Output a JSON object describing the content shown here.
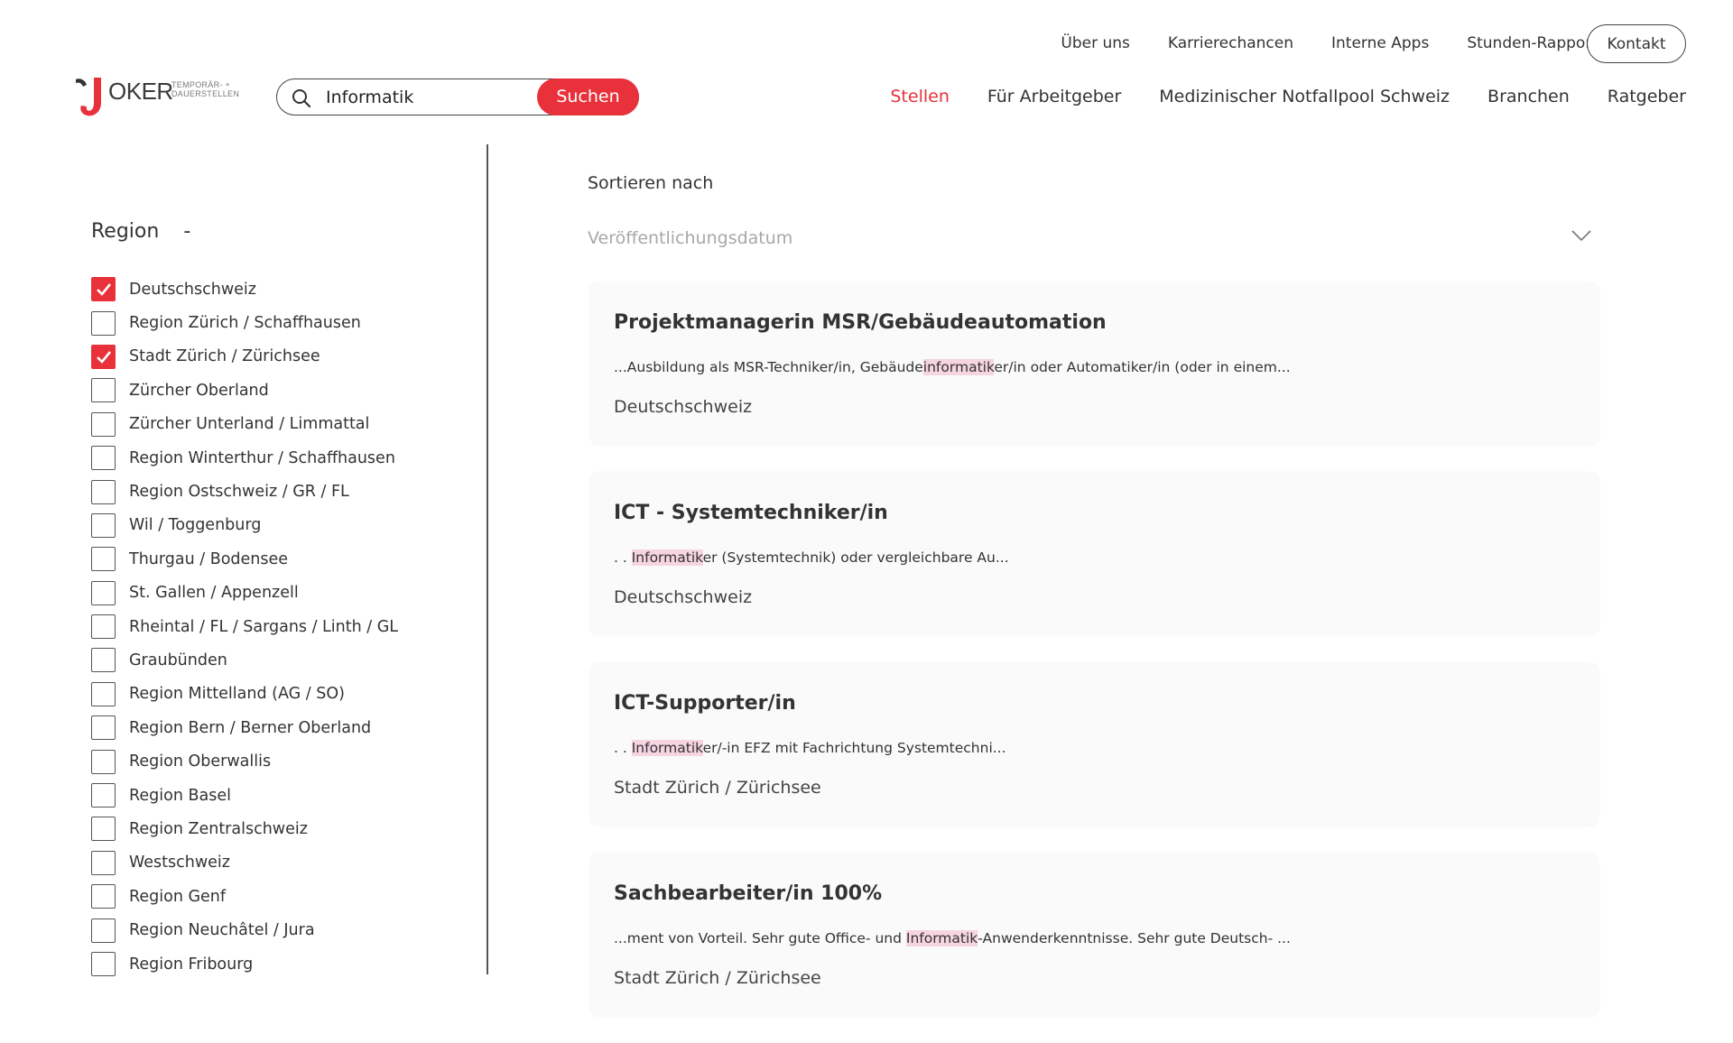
{
  "brand": {
    "logo_text": "OKER",
    "logo_subtitle_1": "TEMPORÄR- +",
    "logo_subtitle_2": "DAUERSTELLEN"
  },
  "search": {
    "value": "Informatik",
    "button_label": "Suchen"
  },
  "top_nav": {
    "items": [
      "Über uns",
      "Karrierechancen",
      "Interne Apps",
      "Stunden-Rapport"
    ],
    "contact_label": "Kontakt"
  },
  "main_nav": {
    "items": [
      "Stellen",
      "Für Arbeitgeber",
      "Medizinischer Notfallpool Schweiz",
      "Branchen",
      "Ratgeber"
    ],
    "active": "Stellen"
  },
  "filters": {
    "title": "Region",
    "toggle": "-",
    "items": [
      {
        "label": "Deutschschweiz",
        "checked": true
      },
      {
        "label": "Region Zürich / Schaffhausen",
        "checked": false
      },
      {
        "label": "Stadt Zürich / Zürichsee",
        "checked": true
      },
      {
        "label": "Zürcher Oberland",
        "checked": false
      },
      {
        "label": "Zürcher Unterland / Limmattal",
        "checked": false
      },
      {
        "label": "Region Winterthur / Schaffhausen",
        "checked": false
      },
      {
        "label": "Region Ostschweiz / GR / FL",
        "checked": false
      },
      {
        "label": "Wil / Toggenburg",
        "checked": false
      },
      {
        "label": "Thurgau / Bodensee",
        "checked": false
      },
      {
        "label": "St. Gallen / Appenzell",
        "checked": false
      },
      {
        "label": "Rheintal / FL / Sargans / Linth / GL",
        "checked": false
      },
      {
        "label": "Graubünden",
        "checked": false
      },
      {
        "label": "Region Mittelland (AG / SO)",
        "checked": false
      },
      {
        "label": "Region Bern / Berner Oberland",
        "checked": false
      },
      {
        "label": "Region Oberwallis",
        "checked": false
      },
      {
        "label": "Region Basel",
        "checked": false
      },
      {
        "label": "Region Zentralschweiz",
        "checked": false
      },
      {
        "label": "Westschweiz",
        "checked": false
      },
      {
        "label": "Region Genf",
        "checked": false
      },
      {
        "label": "Region Neuchâtel / Jura",
        "checked": false
      },
      {
        "label": "Region Fribourg",
        "checked": false
      }
    ]
  },
  "sort": {
    "label": "Sortieren nach",
    "value": "Veröffentlichungsdatum"
  },
  "jobs": [
    {
      "title": "Projektmanagerin MSR/Gebäudeautomation",
      "snippet_before": "...Ausbildung als MSR-Techniker/in, Gebäude",
      "snippet_highlight": "informatik",
      "snippet_after": "er/in oder Automatiker/in (oder in einem...",
      "location": "Deutschschweiz"
    },
    {
      "title": "ICT - Systemtechniker/in",
      "snippet_before": ". . ",
      "snippet_highlight": "Informatik",
      "snippet_after": "er (Systemtechnik) oder vergleichbare Au...",
      "location": "Deutschschweiz"
    },
    {
      "title": "ICT-Supporter/in",
      "snippet_before": ". . ",
      "snippet_highlight": "Informatik",
      "snippet_after": "er/-in EFZ mit Fachrichtung Systemtechni...",
      "location": "Stadt Zürich / Zürichsee"
    },
    {
      "title": "Sachbearbeiter/in 100%",
      "snippet_before": "...ment von Vorteil. Sehr gute Office- und ",
      "snippet_highlight": "Informatik",
      "snippet_after": "-Anwenderkenntnisse. Sehr gute Deutsch- ...",
      "location": "Stadt Zürich / Zürichsee"
    }
  ],
  "colors": {
    "accent": "#e8313a",
    "highlight": "#f6d4e1",
    "card_bg": "#fafafa"
  }
}
